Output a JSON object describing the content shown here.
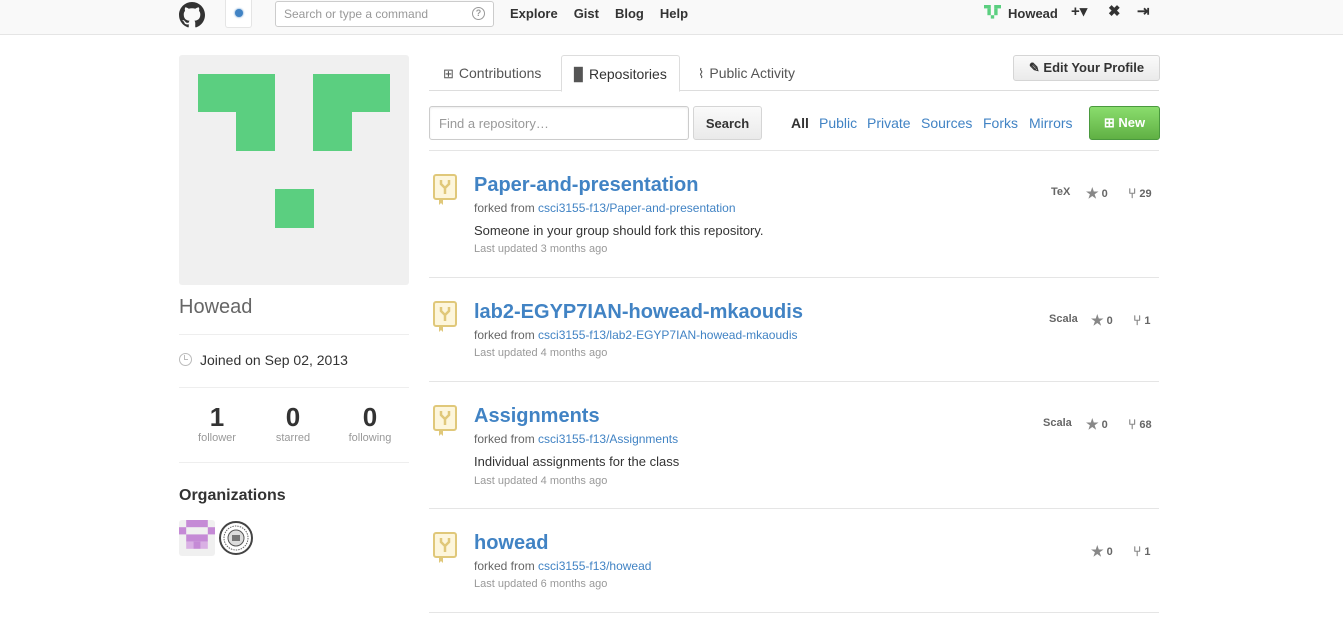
{
  "header": {
    "search_placeholder": "Search or type a command",
    "help_glyph": "?",
    "nav": [
      "Explore",
      "Gist",
      "Blog",
      "Help"
    ],
    "username": "Howead",
    "plus_glyph": "+▾",
    "tools_glyph": "✖",
    "signout_glyph": "⇥"
  },
  "profile": {
    "name": "Howead",
    "joined": "Joined on Sep 02, 2013",
    "stats": [
      {
        "num": "1",
        "label": "follower"
      },
      {
        "num": "0",
        "label": "starred"
      },
      {
        "num": "0",
        "label": "following"
      }
    ],
    "organizations_title": "Organizations"
  },
  "tabs": [
    {
      "label": "Contributions",
      "icon": "plus-square-icon"
    },
    {
      "label": "Repositories",
      "icon": "repo-icon"
    },
    {
      "label": "Public Activity",
      "icon": "rss-icon"
    }
  ],
  "edit_profile": "Edit Your Profile",
  "filter_bar": {
    "find_placeholder": "Find a repository…",
    "search_label": "Search",
    "filters": [
      "All",
      "Public",
      "Private",
      "Sources",
      "Forks",
      "Mirrors"
    ],
    "selected_filter": "All",
    "new_label": "New"
  },
  "repos": [
    {
      "name": "Paper-and-presentation",
      "forked_prefix": "forked from ",
      "forked_from": "csci3155-f13/Paper-and-presentation",
      "description": "Someone in your group should fork this repository.",
      "updated": "Last updated 3 months ago",
      "language": "TeX",
      "stars": "0",
      "forks": "29"
    },
    {
      "name": "lab2-EGYP7IAN-howead-mkaoudis",
      "forked_prefix": "forked from ",
      "forked_from": "csci3155-f13/lab2-EGYP7IAN-howead-mkaoudis",
      "description": "",
      "updated": "Last updated 4 months ago",
      "language": "Scala",
      "stars": "0",
      "forks": "1"
    },
    {
      "name": "Assignments",
      "forked_prefix": "forked from ",
      "forked_from": "csci3155-f13/Assignments",
      "description": "Individual assignments for the class",
      "updated": "Last updated 4 months ago",
      "language": "Scala",
      "stars": "0",
      "forks": "68"
    },
    {
      "name": "howead",
      "forked_prefix": "forked from ",
      "forked_from": "csci3155-f13/howead",
      "description": "",
      "updated": "Last updated 6 months ago",
      "language": "",
      "stars": "0",
      "forks": "1"
    }
  ],
  "colors": {
    "link": "#4183c4",
    "identicon_green": "#5bcf80",
    "new_button": "#60b044",
    "org_identicon": "#c58ad6",
    "repo_icon": "#e0c87a"
  }
}
